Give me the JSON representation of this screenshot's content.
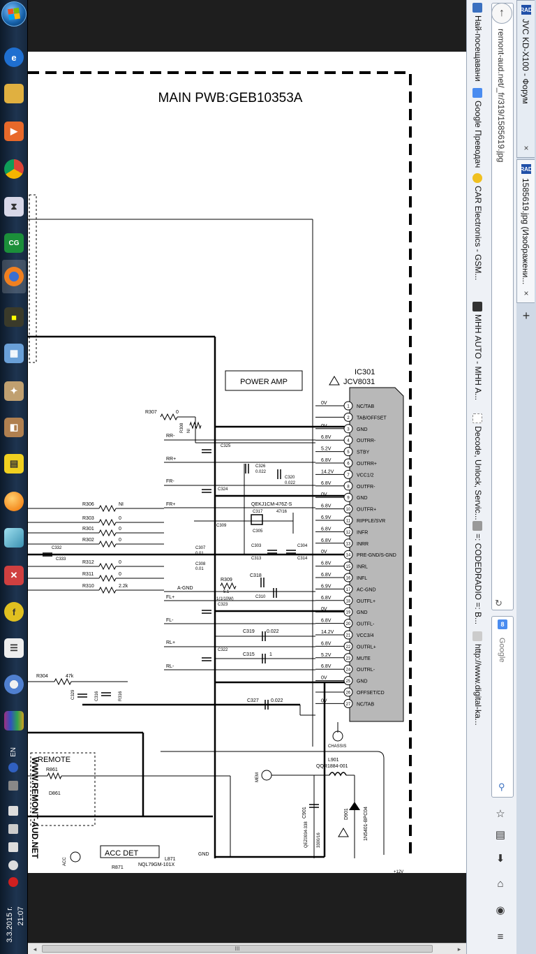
{
  "browser": {
    "tabs": [
      {
        "label": "JVC KD-X100 - Форум",
        "favicon": "RAD"
      },
      {
        "label": "1585619.jpg (Изображени...",
        "favicon": "RAD"
      }
    ],
    "url": "remont-aud.net/_fr/319/1585619.jpg",
    "search_engine_badge": "8",
    "search_placeholder": "Google",
    "bookmarks": [
      "Най-посещавани",
      "Google Преводач",
      "CAR Electronics - GSM...",
      "МНН AUTO - МНН А...",
      "Decode, Unlock, Servic...",
      "=: CODEDRADIO =: B...",
      "http://www.digital-ka..."
    ]
  },
  "taskbar": {
    "language": "EN",
    "time": "21:07",
    "date": "3.3.2015 г."
  },
  "scrollbar": {
    "thumb_label": "III"
  },
  "schematic": {
    "title": "MAIN PWB:GEB10353A",
    "power_amp_label": "POWER AMP",
    "ic_ref": "IC301",
    "ic_part": "JCV8031",
    "remote_label": "REMOTE",
    "acc_det_label": "ACC DET",
    "watermark": "WWW.REMONT-AUD.NET",
    "pins": [
      {
        "n": "1",
        "name": "NC/TAB",
        "v": "0V"
      },
      {
        "n": "2",
        "name": "TAB/OFFSET",
        "v": ""
      },
      {
        "n": "3",
        "name": "GND",
        "v": "0V"
      },
      {
        "n": "4",
        "name": "OUTRR-",
        "v": "6.8V"
      },
      {
        "n": "5",
        "name": "STBY",
        "v": "5.2V"
      },
      {
        "n": "6",
        "name": "OUTRR+",
        "v": "6.8V"
      },
      {
        "n": "7",
        "name": "VCC1/2",
        "v": "14.2V"
      },
      {
        "n": "8",
        "name": "OUTFR-",
        "v": "6.8V"
      },
      {
        "n": "9",
        "name": "GND",
        "v": "0V"
      },
      {
        "n": "10",
        "name": "OUTFR+",
        "v": "6.8V"
      },
      {
        "n": "11",
        "name": "RIPPLE/SVR",
        "v": "6.9V"
      },
      {
        "n": "12",
        "name": "INFR",
        "v": "6.8V"
      },
      {
        "n": "13",
        "name": "INRR",
        "v": "6.8V"
      },
      {
        "n": "14",
        "name": "PRE-GND/S-GND",
        "v": "0V"
      },
      {
        "n": "15",
        "name": "INRL",
        "v": "6.8V"
      },
      {
        "n": "16",
        "name": "INFL",
        "v": "6.8V"
      },
      {
        "n": "17",
        "name": "AC-GND",
        "v": "6.9V"
      },
      {
        "n": "18",
        "name": "OUTFL+",
        "v": "6.8V"
      },
      {
        "n": "19",
        "name": "GND",
        "v": "0V"
      },
      {
        "n": "20",
        "name": "OUTFL-",
        "v": "6.8V"
      },
      {
        "n": "21",
        "name": "VCC3/4",
        "v": "14.2V"
      },
      {
        "n": "22",
        "name": "OUTRL+",
        "v": "6.8V"
      },
      {
        "n": "23",
        "name": "MUTE",
        "v": "5.2V"
      },
      {
        "n": "24",
        "name": "OUTRL-",
        "v": "6.8V"
      },
      {
        "n": "25",
        "name": "GND",
        "v": "0V"
      },
      {
        "n": "26",
        "name": "OFFSET/CD",
        "v": ""
      },
      {
        "n": "27",
        "name": "NC/TAB",
        "v": "0V"
      }
    ],
    "labels": [
      {
        "t": "R307",
        "k": "r307"
      },
      {
        "t": "0",
        "k": "r307v"
      },
      {
        "t": "R308",
        "k": "r308"
      },
      {
        "t": "NI",
        "k": "r308v"
      },
      {
        "t": "RR-",
        "k": "rrm"
      },
      {
        "t": "RR+",
        "k": "rrp"
      },
      {
        "t": "FR-",
        "k": "frm"
      },
      {
        "t": "FR+",
        "k": "frp"
      },
      {
        "t": "FL+",
        "k": "flp"
      },
      {
        "t": "FL-",
        "k": "flm"
      },
      {
        "t": "RL+",
        "k": "rlp"
      },
      {
        "t": "RL-",
        "k": "rlm"
      },
      {
        "t": "A-GND",
        "k": "agnd"
      },
      {
        "t": "C325",
        "k": "c325"
      },
      {
        "t": "C326",
        "k": "c326"
      },
      {
        "t": "0.022",
        "k": "c326v"
      },
      {
        "t": "C320",
        "k": "c320"
      },
      {
        "t": "0.022",
        "k": "c320v"
      },
      {
        "t": "C324",
        "k": "c324"
      },
      {
        "t": "QEKJ1CM-476Z-S",
        "k": "qekj"
      },
      {
        "t": "C317",
        "k": "c317"
      },
      {
        "t": "47/16",
        "k": "c317v"
      },
      {
        "t": "C309",
        "k": "c309"
      },
      {
        "t": "C305",
        "k": "c305"
      },
      {
        "t": "R306",
        "k": "r306"
      },
      {
        "t": "NI",
        "k": "r306v"
      },
      {
        "t": "R303",
        "k": "r303"
      },
      {
        "t": "0",
        "k": "r303v"
      },
      {
        "t": "R301",
        "k": "r301"
      },
      {
        "t": "0",
        "k": "r301v"
      },
      {
        "t": "R302",
        "k": "r302"
      },
      {
        "t": "0",
        "k": "r302v"
      },
      {
        "t": "R312",
        "k": "r312"
      },
      {
        "t": "0",
        "k": "r312v"
      },
      {
        "t": "R311",
        "k": "r311"
      },
      {
        "t": "0",
        "k": "r311v"
      },
      {
        "t": "R310",
        "k": "r310"
      },
      {
        "t": "2.2k",
        "k": "r310v"
      },
      {
        "t": "C332",
        "k": "c332"
      },
      {
        "t": "C333",
        "k": "c333"
      },
      {
        "t": "C307",
        "k": "c307"
      },
      {
        "t": "0.01",
        "k": "c307v"
      },
      {
        "t": "C308",
        "k": "c308"
      },
      {
        "t": "0.01",
        "k": "c308v"
      },
      {
        "t": "C303",
        "k": "c303"
      },
      {
        "t": "C304",
        "k": "c304"
      },
      {
        "t": "C313",
        "k": "c313"
      },
      {
        "t": "C314",
        "k": "c314"
      },
      {
        "t": "R309",
        "k": "r309"
      },
      {
        "t": "5.1",
        "k": "r309v"
      },
      {
        "t": "1(1/10W)",
        "k": "r309w"
      },
      {
        "t": "C318",
        "k": "c318"
      },
      {
        "t": "C310",
        "k": "c310"
      },
      {
        "t": "C323",
        "k": "c323"
      },
      {
        "t": "C319",
        "k": "c319"
      },
      {
        "t": "0.022",
        "k": "c319v"
      },
      {
        "t": "C322",
        "k": "c322"
      },
      {
        "t": "C315",
        "k": "c315"
      },
      {
        "t": "1",
        "k": "c315v"
      },
      {
        "t": "R304",
        "k": "r304"
      },
      {
        "t": "47k",
        "k": "r304v"
      },
      {
        "t": "C329",
        "k": "c329"
      },
      {
        "t": "C316",
        "k": "c316"
      },
      {
        "t": "R316",
        "k": "r316"
      },
      {
        "t": "C327",
        "k": "c327"
      },
      {
        "t": "0.022",
        "k": "c327v"
      },
      {
        "t": "CHASSIS",
        "k": "chassis"
      },
      {
        "t": "L901",
        "k": "l901"
      },
      {
        "t": "QQR1884-001",
        "k": "l901p"
      },
      {
        "t": "MEM",
        "k": "mem"
      },
      {
        "t": "C901",
        "k": "c901"
      },
      {
        "t": "QEZ0934-338",
        "k": "c901p"
      },
      {
        "t": "3300/16",
        "k": "c901v"
      },
      {
        "t": "D901",
        "k": "d901"
      },
      {
        "t": "1N5401-BPC04",
        "k": "d901p"
      },
      {
        "t": "R861",
        "k": "r861"
      },
      {
        "t": "D861",
        "k": "d861"
      },
      {
        "t": "ACC",
        "k": "acc"
      },
      {
        "t": "R871",
        "k": "r871"
      },
      {
        "t": "L871",
        "k": "l871"
      },
      {
        "t": "NQL79GM-101X",
        "k": "l871p"
      },
      {
        "t": "GND",
        "k": "gnd"
      },
      {
        "t": "+12V",
        "k": "v12"
      }
    ]
  }
}
